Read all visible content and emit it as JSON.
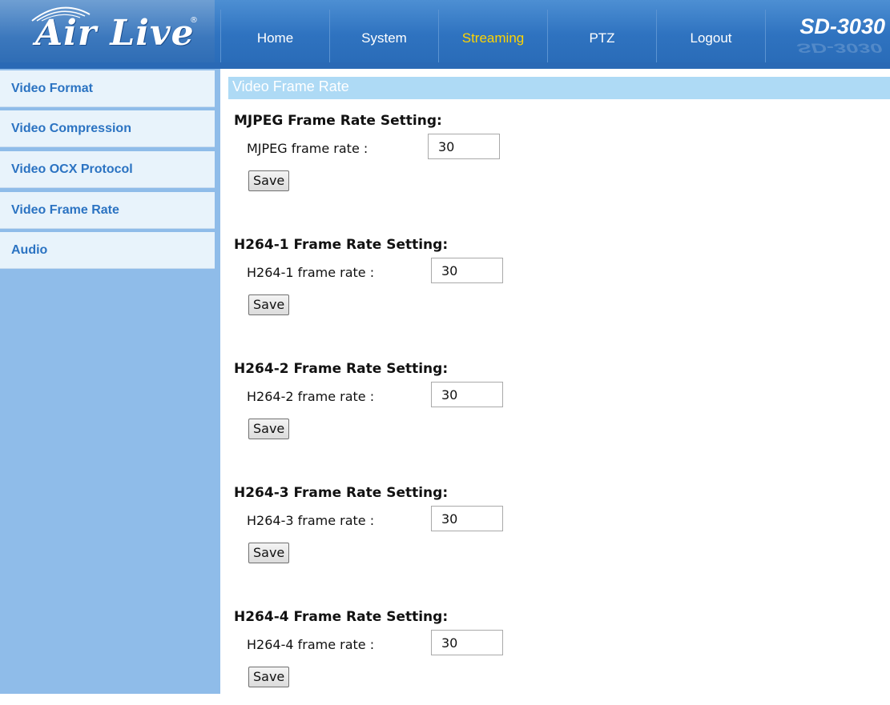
{
  "header": {
    "logo_text": "Air Live",
    "logo_reg": "®",
    "model": "SD-3030",
    "nav": [
      "Home",
      "System",
      "Streaming",
      "PTZ",
      "Logout"
    ],
    "active_nav": "Streaming",
    "colors": {
      "nav_active": "#ffd400",
      "header_bg": "#2f73c0"
    }
  },
  "sidebar": {
    "items": [
      {
        "label": "Video Format"
      },
      {
        "label": "Video Compression"
      },
      {
        "label": "Video OCX Protocol"
      },
      {
        "label": "Video Frame Rate"
      },
      {
        "label": "Audio"
      }
    ]
  },
  "main": {
    "section_title": "Video Frame Rate",
    "blocks": [
      {
        "heading": "MJPEG Frame Rate Setting:",
        "label": "MJPEG frame rate :",
        "value": "30",
        "save_label": "Save"
      },
      {
        "heading": "H264-1 Frame Rate Setting:",
        "label": "H264-1 frame rate :",
        "value": "30",
        "save_label": "Save"
      },
      {
        "heading": "H264-2 Frame Rate Setting:",
        "label": "H264-2 frame rate :",
        "value": "30",
        "save_label": "Save"
      },
      {
        "heading": "H264-3 Frame Rate Setting:",
        "label": "H264-3 frame rate :",
        "value": "30",
        "save_label": "Save"
      },
      {
        "heading": "H264-4 Frame Rate Setting:",
        "label": "H264-4 frame rate :",
        "value": "30",
        "save_label": "Save"
      }
    ]
  }
}
